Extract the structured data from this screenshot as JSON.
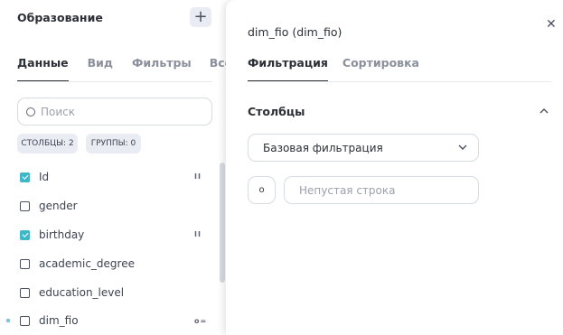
{
  "left_panel": {
    "title": "Образование",
    "add_icon": "plus-icon",
    "tabs": [
      "Данные",
      "Вид",
      "Фильтры",
      "Все"
    ],
    "active_tab": "Данные",
    "search": {
      "placeholder": "Поиск",
      "value": ""
    },
    "chips": {
      "columns": "СТОЛБЦЫ: 2",
      "groups": "ГРУППЫ: 0"
    },
    "fields": [
      {
        "name": "Id",
        "checked": true,
        "icon": "drag-handle-icon",
        "icon_glyph": "II"
      },
      {
        "name": "gender",
        "checked": false
      },
      {
        "name": "birthday",
        "checked": true,
        "icon": "drag-handle-icon",
        "icon_glyph": "II"
      },
      {
        "name": "academic_degree",
        "checked": false
      },
      {
        "name": "education_level",
        "checked": false
      },
      {
        "name": "dim_fio",
        "checked": false,
        "icon": "link-icon",
        "icon_glyph": "o="
      }
    ]
  },
  "right_panel": {
    "title": "dim_fio (dim_fio)",
    "close_icon": "close-icon",
    "tabs": [
      "Фильтрация",
      "Сортировка"
    ],
    "active_tab": "Фильтрация",
    "section": {
      "title": "Столбцы",
      "icon": "chevron-up-icon"
    },
    "filter_type": {
      "value": "Базовая фильтрация",
      "icon": "chevron-down-icon"
    },
    "operator": {
      "label": "о"
    },
    "value_input": {
      "placeholder": "Непустая строка",
      "value": ""
    }
  },
  "colors": {
    "accent": "#3fb7c6",
    "border": "#d7dbe2",
    "chip_bg": "#e9ecf2"
  }
}
